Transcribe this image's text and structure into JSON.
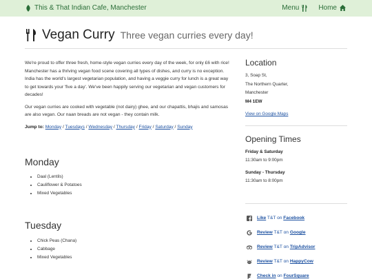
{
  "navbar": {
    "brand": "This & That Indian Cafe, Manchester",
    "menu_label": "Menu",
    "home_label": "Home"
  },
  "page": {
    "title": "Vegan Curry",
    "subtitle": "Three vegan curries every day!"
  },
  "intro": {
    "p1": "We're proud to offer three fresh, home-style vegan curries every day of the week, for only £6 with rice! Manchester has a thriving vegan food scene covering all types of dishes, and curry is no exception. India has the world's largest vegetarian population, and having a veggie curry for lunch is a great way to get towards your 'five a day'. We've been happily serving our vegetarian and vegan customers for decades!",
    "p2": "Our vegan curries are cooked with vegetable (not dairy) ghee, and our chapattis, bhajis and samosas are also vegan. Our naan breads are not vegan - they contain milk.",
    "jump_label": "Jump to:",
    "jump_links": [
      "Monday",
      "Tuesdays",
      "Wednesday",
      "Thursday",
      "Friday",
      "Saturday",
      "Sunday"
    ]
  },
  "days": [
    {
      "name": "Monday",
      "items": [
        "Daal (Lentils)",
        "Cauliflower & Potatoes",
        "Mixed Vegetables"
      ]
    },
    {
      "name": "Tuesday",
      "items": [
        "Chick Peas (Chana)",
        "Cabbage",
        "Mixed Vegetables"
      ]
    }
  ],
  "location": {
    "heading": "Location",
    "line1": "3, Soap St,",
    "line2": "The Northern Quarter,",
    "line3": "Manchester",
    "postcode": "M4 1EW",
    "map_link": "View on Google Maps"
  },
  "opening": {
    "heading": "Opening Times",
    "label1": "Friday & Saturday",
    "hours1": "11:30am to 9:00pm",
    "label2": "Sunday - Thursday",
    "hours2": "11:30am to 8:00pm"
  },
  "social": [
    {
      "icon": "facebook-icon",
      "action": "Like",
      "mid": "T&T on",
      "site": "Facebook"
    },
    {
      "icon": "google-icon",
      "action": "Review",
      "mid": "T&T on",
      "site": "Google"
    },
    {
      "icon": "tripadvisor-icon",
      "action": "Review",
      "mid": "T&T on",
      "site": "TripAdvisor"
    },
    {
      "icon": "happycow-icon",
      "action": "Review",
      "mid": "T&T on",
      "site": "HappyCow"
    },
    {
      "icon": "foursquare-icon",
      "action": "Check in",
      "mid": "on",
      "site": "FourSquare"
    }
  ],
  "colors": {
    "navbar_bg": "#dff0d8",
    "navbar_text": "#2a6d37",
    "link": "#1a4fa0"
  }
}
